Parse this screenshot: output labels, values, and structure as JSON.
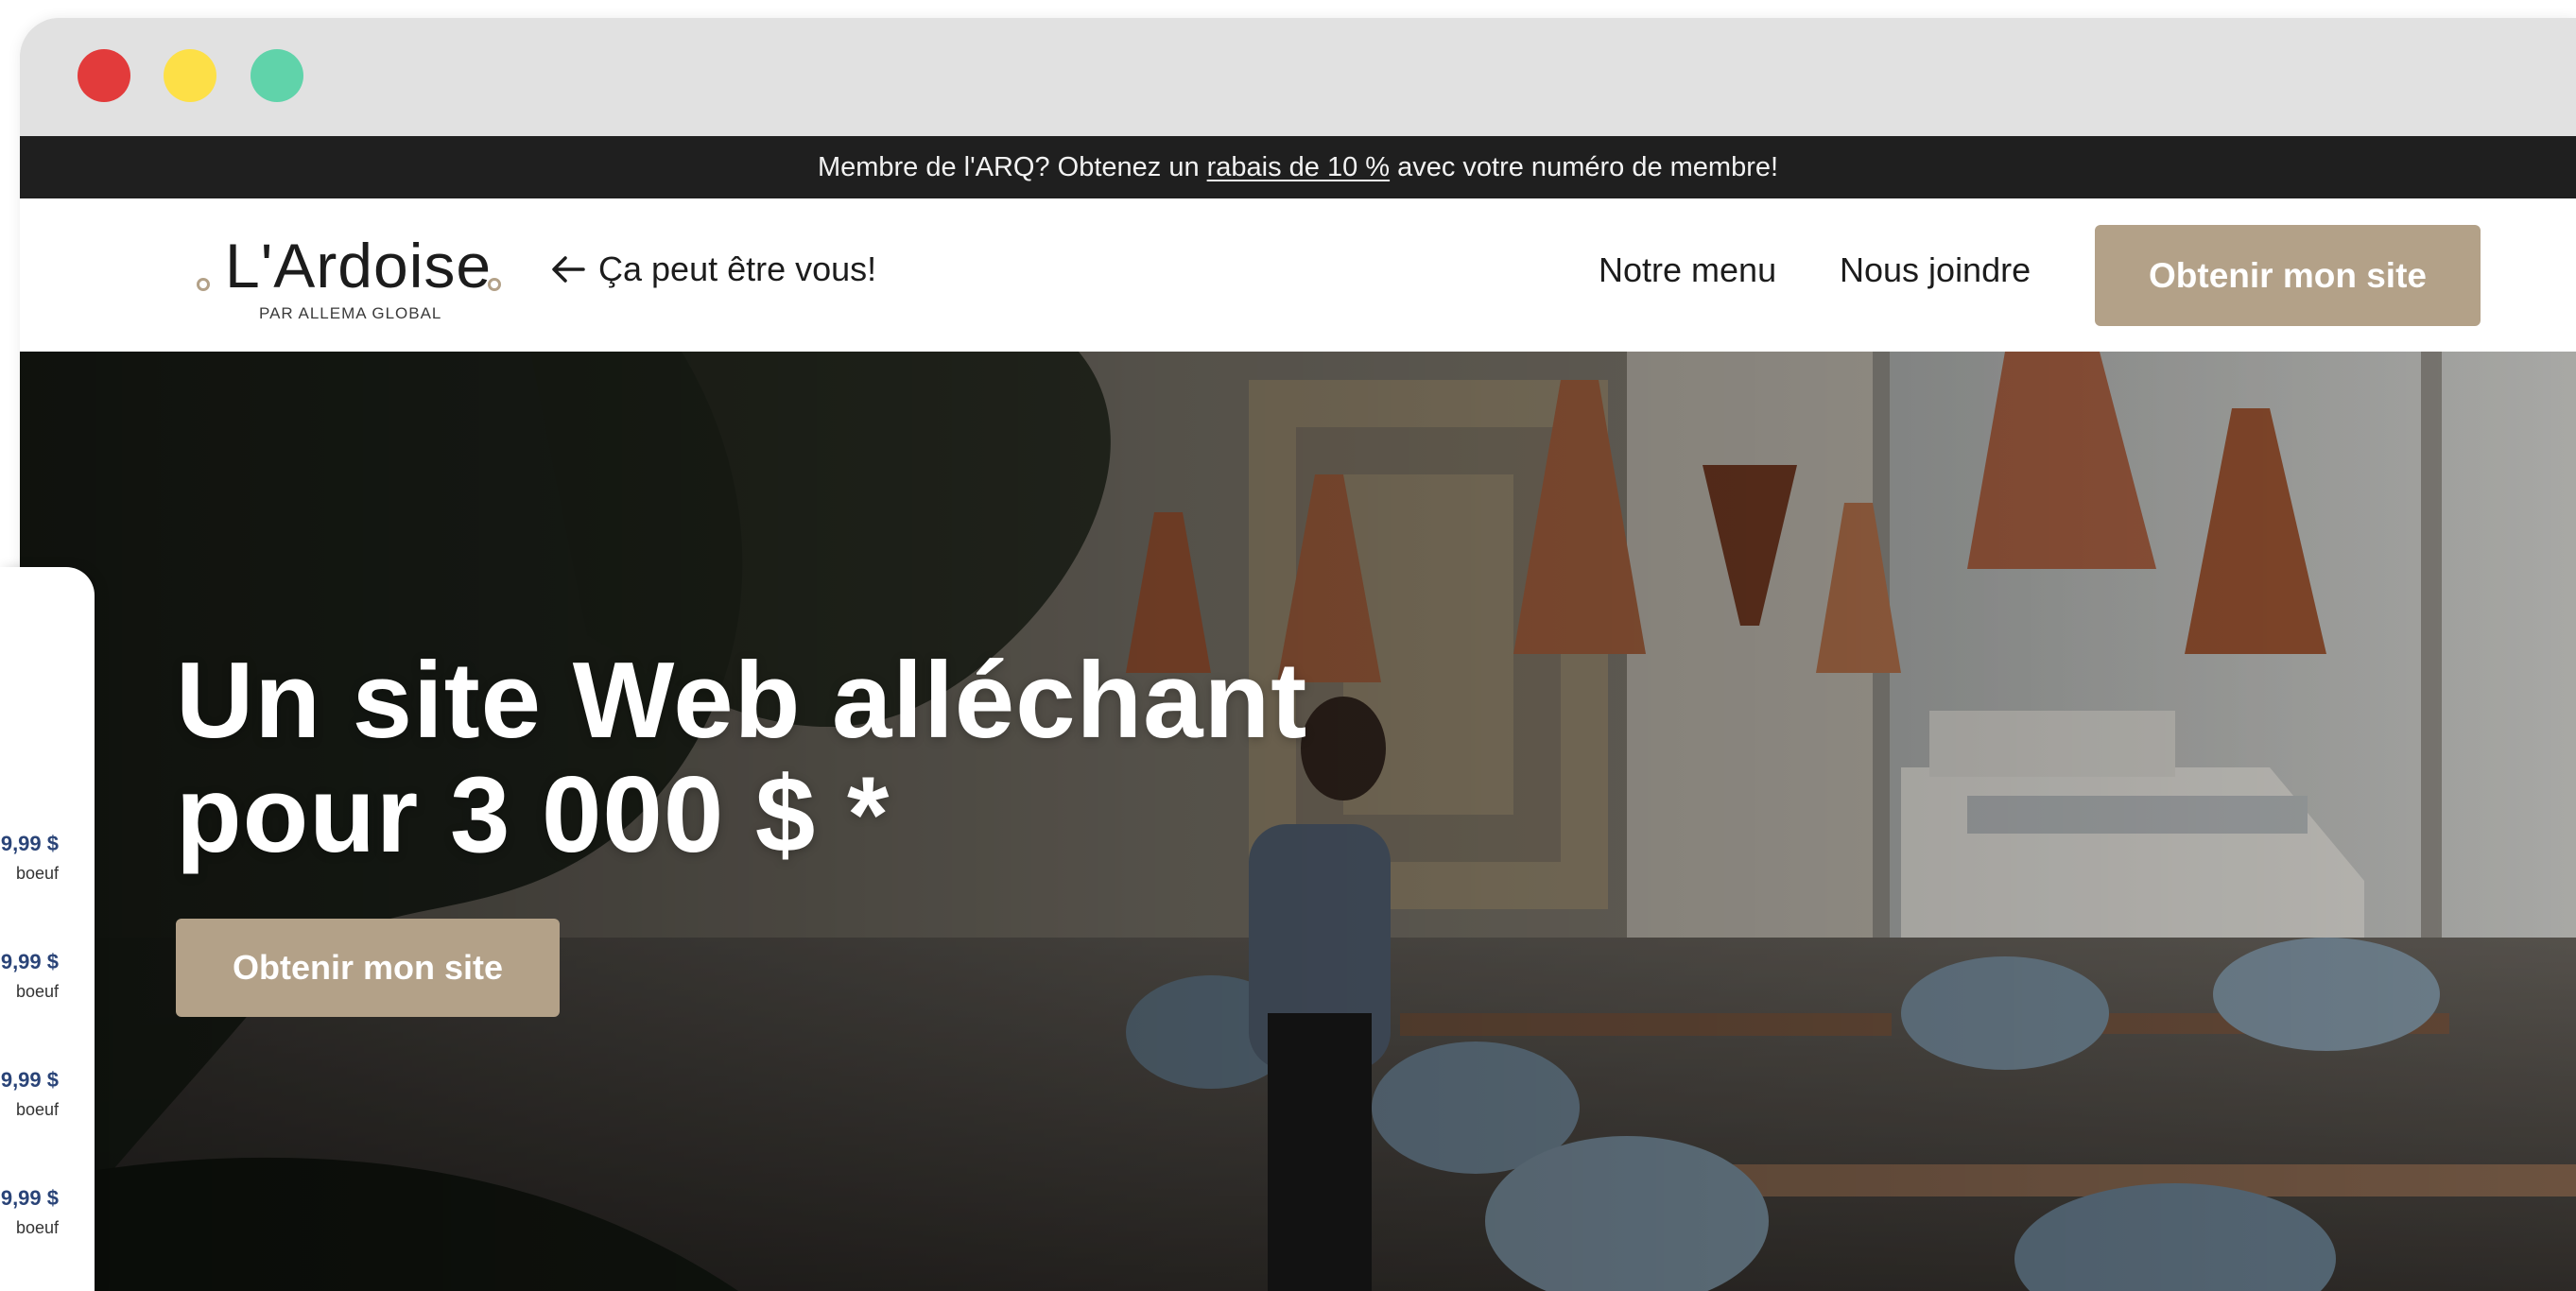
{
  "window": {
    "controls": [
      {
        "name": "close",
        "color": "#e23b3b"
      },
      {
        "name": "minimize",
        "color": "#fde047"
      },
      {
        "name": "maximize",
        "color": "#60d3aa"
      }
    ]
  },
  "announcement": {
    "before": "Membre de l'ARQ? Obtenez un",
    "link": "rabais de 10 %",
    "after": "avec votre numéro de membre!"
  },
  "header": {
    "logo": {
      "name": "L'Ardoise",
      "tagline": "PAR ALLEMA GLOBAL"
    },
    "back_link": "Ça peut être vous!",
    "nav": {
      "menu": "Notre menu",
      "contact": "Nous joindre"
    },
    "cta": "Obtenir mon site"
  },
  "hero": {
    "title_line1": "Un site Web alléchant",
    "title_line2": "pour 3 000 $ *",
    "cta": "Obtenir mon site"
  },
  "menu_card": {
    "items": [
      {
        "price": "9,99 $",
        "desc": "boeuf"
      },
      {
        "price": "9,99 $",
        "desc": "boeuf"
      },
      {
        "price": "9,99 $",
        "desc": "boeuf"
      },
      {
        "price": "9,99 $",
        "desc": "boeuf"
      }
    ]
  },
  "colors": {
    "accent": "#b3a188",
    "announcement_bg": "#1f1f1f",
    "titlebar_bg": "#e1e1e1",
    "price_text": "#2a4478"
  }
}
